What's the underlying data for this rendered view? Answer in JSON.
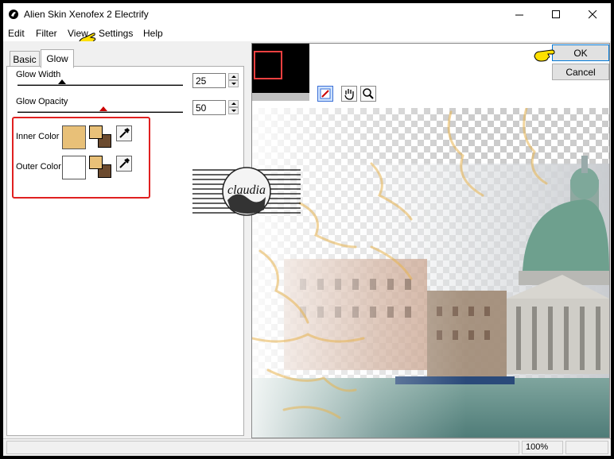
{
  "window": {
    "title": "Alien Skin Xenofex 2 Electrify"
  },
  "menu": {
    "edit": "Edit",
    "filter": "Filter",
    "view": "View",
    "settings": "Settings",
    "help": "Help"
  },
  "tabs": {
    "basic": "Basic",
    "glow": "Glow"
  },
  "glow": {
    "width_label": "Glow Width",
    "width_value": "25",
    "opacity_label": "Glow Opacity",
    "opacity_value": "50",
    "inner_label": "Inner Color",
    "outer_label": "Outer Color",
    "inner_color": "#e8c078",
    "outer_color": "#ffffff",
    "swatch_fg": "#e8c078",
    "swatch_bg": "#6b4a2e"
  },
  "buttons": {
    "ok": "OK",
    "cancel": "Cancel"
  },
  "status": {
    "zoom": "100%"
  },
  "watermark": {
    "text": "claudia"
  },
  "colors": {
    "highlight": "#e02020",
    "pointer": "#ffe000"
  }
}
